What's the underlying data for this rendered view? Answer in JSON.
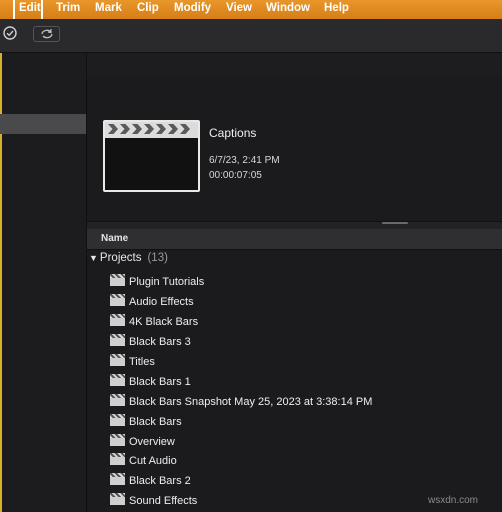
{
  "menubar": {
    "items": [
      "Edit",
      "Trim",
      "Mark",
      "Clip",
      "Modify",
      "View",
      "Window",
      "Help"
    ],
    "highlighted": "Edit",
    "accent_color": "#e08a1f"
  },
  "toolbar": {
    "icons": [
      "checkmark-circle-icon",
      "sync-icon"
    ]
  },
  "project_preview": {
    "title": "Captions",
    "date": "6/7/23, 2:41 PM",
    "duration": "00:00:07:05",
    "thumbnail_icon": "clapperboard-icon"
  },
  "list": {
    "header": "Name",
    "group": {
      "label": "Projects",
      "count": "(13)"
    },
    "items": [
      "Plugin Tutorials",
      "Audio Effects",
      "4K Black Bars",
      "Black Bars 3",
      "Titles",
      "Black Bars 1",
      "Black Bars Snapshot May 25, 2023 at 3:38:14 PM",
      "Black Bars",
      "Overview",
      "Cut Audio",
      "Black Bars 2",
      "Sound Effects"
    ],
    "item_icon": "clapperboard-icon"
  },
  "watermark": "wsxdn.com"
}
